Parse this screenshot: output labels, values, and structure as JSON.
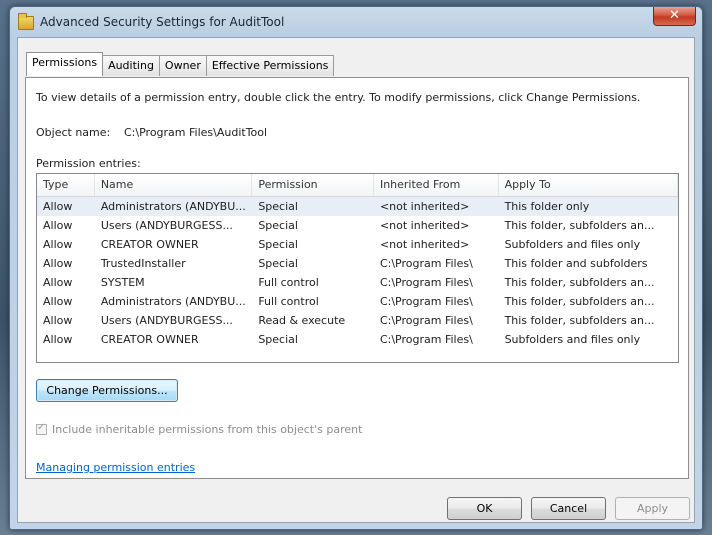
{
  "window": {
    "title": "Advanced Security Settings for AuditTool",
    "close_label": "✕"
  },
  "tabs": [
    {
      "label": "Permissions"
    },
    {
      "label": "Auditing"
    },
    {
      "label": "Owner"
    },
    {
      "label": "Effective Permissions"
    }
  ],
  "permissions": {
    "instruction": "To view details of a permission entry, double click the entry. To modify permissions, click Change Permissions.",
    "object_name_label": "Object name:",
    "object_name_value": "C:\\Program Files\\AuditTool",
    "entries_label": "Permission entries:",
    "columns": [
      "Type",
      "Name",
      "Permission",
      "Inherited From",
      "Apply To"
    ],
    "rows": [
      {
        "type": "Allow",
        "name": "Administrators (ANDYBU...",
        "permission": "Special",
        "inherited": "<not inherited>",
        "apply_to": "This folder only"
      },
      {
        "type": "Allow",
        "name": "Users (ANDYBURGESS...",
        "permission": "Special",
        "inherited": "<not inherited>",
        "apply_to": "This folder, subfolders an..."
      },
      {
        "type": "Allow",
        "name": "CREATOR OWNER",
        "permission": "Special",
        "inherited": "<not inherited>",
        "apply_to": "Subfolders and files only"
      },
      {
        "type": "Allow",
        "name": "TrustedInstaller",
        "permission": "Special",
        "inherited": "C:\\Program Files\\",
        "apply_to": "This folder and subfolders"
      },
      {
        "type": "Allow",
        "name": "SYSTEM",
        "permission": "Full control",
        "inherited": "C:\\Program Files\\",
        "apply_to": "This folder, subfolders an..."
      },
      {
        "type": "Allow",
        "name": "Administrators (ANDYBU...",
        "permission": "Full control",
        "inherited": "C:\\Program Files\\",
        "apply_to": "This folder, subfolders an..."
      },
      {
        "type": "Allow",
        "name": "Users (ANDYBURGESS...",
        "permission": "Read & execute",
        "inherited": "C:\\Program Files\\",
        "apply_to": "This folder, subfolders an..."
      },
      {
        "type": "Allow",
        "name": "CREATOR OWNER",
        "permission": "Special",
        "inherited": "C:\\Program Files\\",
        "apply_to": "Subfolders and files only"
      }
    ],
    "change_button": "Change Permissions...",
    "inherit_checkbox_label": "Include inheritable permissions from this object's parent",
    "inherit_checked": true,
    "manage_link": "Managing permission entries"
  },
  "footer": {
    "ok": "OK",
    "cancel": "Cancel",
    "apply": "Apply"
  }
}
